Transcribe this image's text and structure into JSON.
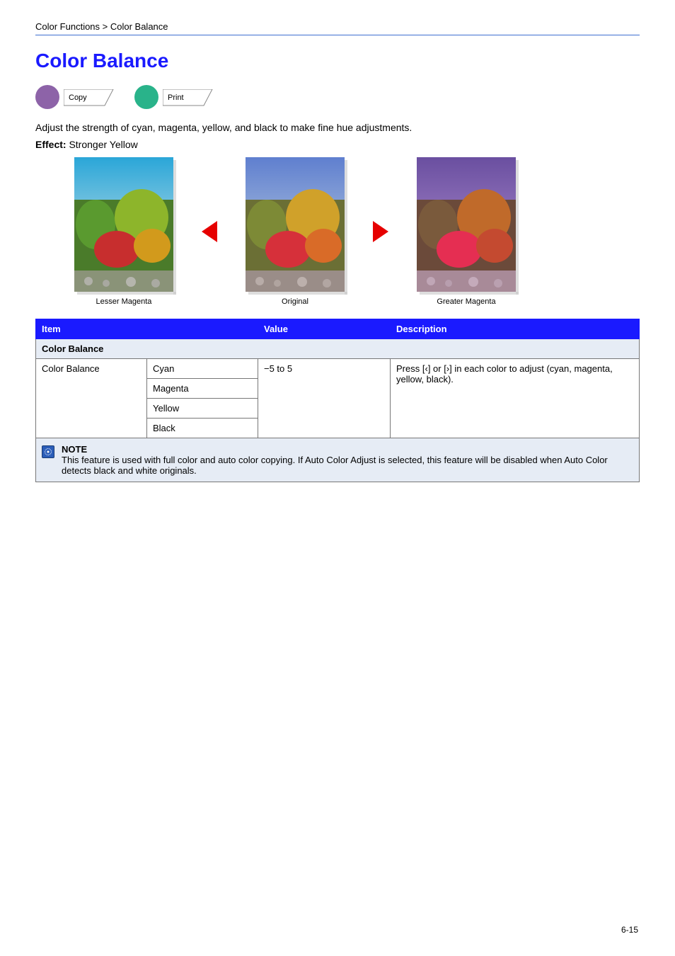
{
  "breadcrumb": "Color Functions > Color Balance",
  "title": "Color Balance",
  "badges": [
    {
      "dot_color": "purple",
      "tag_text": "Copy"
    },
    {
      "dot_color": "green",
      "tag_text": "Print"
    }
  ],
  "description": "Adjust the strength of cyan, magenta, yellow, and black to make fine hue adjustments.",
  "effect_label": "Effect: ",
  "effect_text": "Stronger Yellow",
  "images": {
    "left_caption": "Lesser Magenta",
    "center_caption": "Original",
    "right_caption": "Greater Magenta"
  },
  "table": {
    "headers": [
      "Item",
      "Value",
      "Description"
    ],
    "subhead": "Color Balance",
    "row1": {
      "item": "Color Balance",
      "values": [
        "Cyan",
        "Magenta",
        "Yellow",
        "Black"
      ],
      "value_col": "−5 to 5",
      "description": "Press [ ] or [ ] in each color to adjust (cyan, magenta, yellow, black)."
    }
  },
  "note": {
    "label": "NOTE",
    "text": "This feature is used with full color and auto color copying. If Auto Color Adjust is selected, this feature will be disabled when Auto Color detects black and white originals."
  },
  "page_number": "6-15"
}
